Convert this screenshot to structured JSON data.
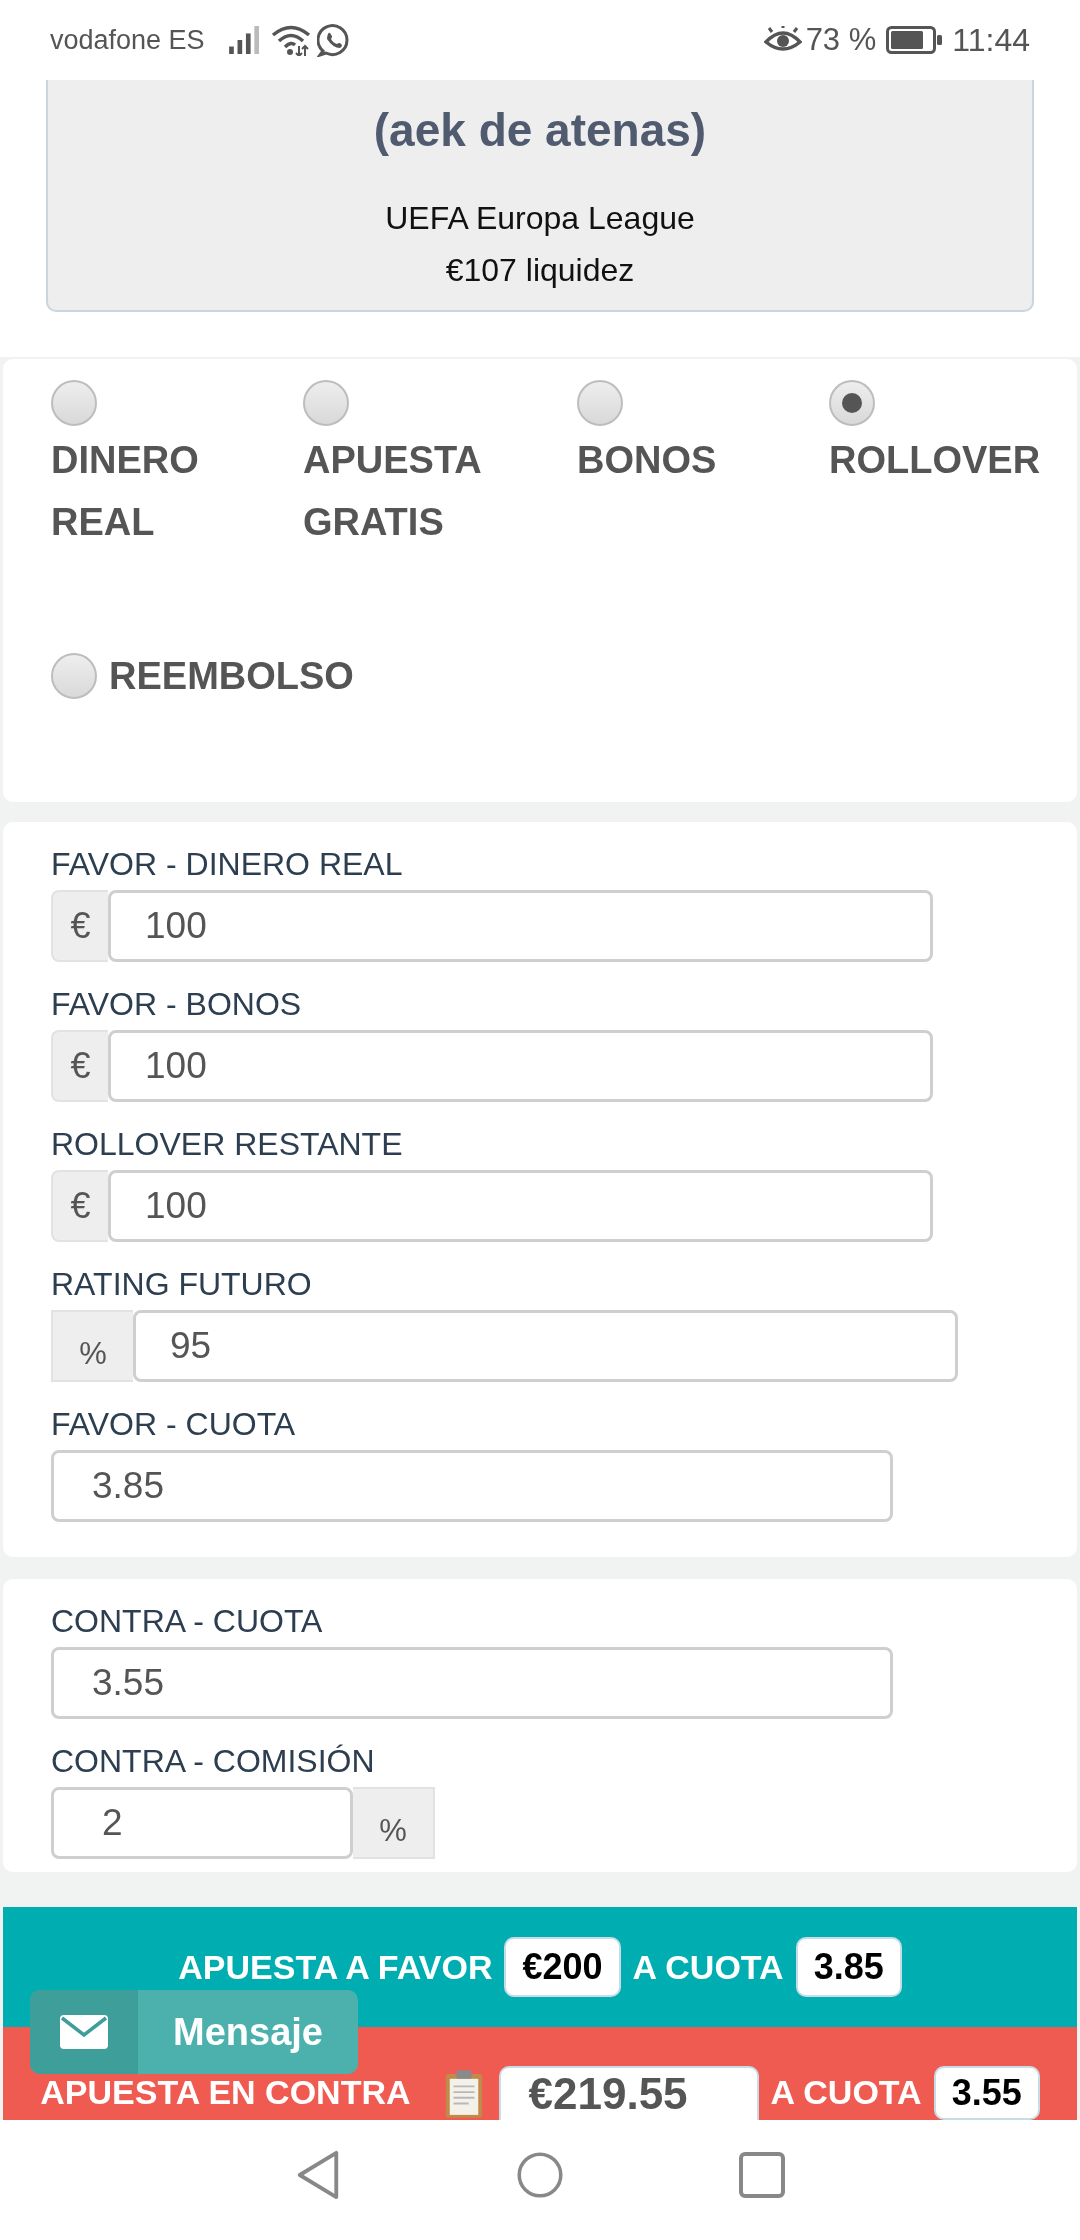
{
  "status_bar": {
    "carrier": "vodafone ES",
    "battery": "73 %",
    "time": "11:44"
  },
  "event": {
    "title": "(aek de atenas)",
    "competition": "UEFA Europa League",
    "liquidity": "€107 liquidez"
  },
  "bet_types": [
    {
      "label": "DINERO REAL",
      "selected": false
    },
    {
      "label": "APUESTA GRATIS",
      "selected": false
    },
    {
      "label": "BONOS",
      "selected": false
    },
    {
      "label": "ROLLOVER",
      "selected": true
    },
    {
      "label": "REEMBOLSO",
      "selected": false
    }
  ],
  "favor_fields": [
    {
      "label": "FAVOR - DINERO REAL",
      "kind": "euro",
      "unit": "€",
      "value": "100"
    },
    {
      "label": "FAVOR - BONOS",
      "kind": "euro",
      "unit": "€",
      "value": "100"
    },
    {
      "label": "ROLLOVER RESTANTE",
      "kind": "euro",
      "unit": "€",
      "value": "100"
    },
    {
      "label": "RATING FUTURO",
      "kind": "rating",
      "unit": "%",
      "value": "95"
    },
    {
      "label": "FAVOR - CUOTA",
      "kind": "plain",
      "value": "3.85"
    }
  ],
  "contra_fields": [
    {
      "label": "CONTRA - CUOTA",
      "kind": "plain",
      "value": "3.55"
    },
    {
      "label": "CONTRA - COMISIÓN",
      "kind": "commission",
      "unit": "%",
      "value": "2"
    }
  ],
  "bets": [
    {
      "kind": "favor",
      "label": "APUESTA A FAVOR",
      "stake": "€200",
      "odds_label": "A CUOTA",
      "odds": "3.85"
    },
    {
      "kind": "contra",
      "label": "APUESTA EN CONTRA",
      "stake": "€219.55",
      "odds_label": "A CUOTA",
      "odds": "3.55"
    }
  ],
  "message_button": {
    "label": "Mensaje"
  }
}
